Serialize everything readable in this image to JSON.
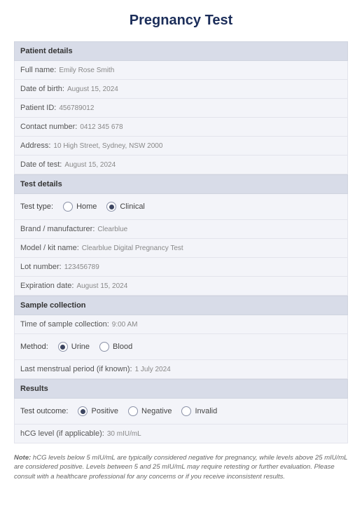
{
  "title": "Pregnancy Test",
  "sections": {
    "patient": {
      "header": "Patient details",
      "fullname_label": "Full name:",
      "fullname_value": "Emily Rose Smith",
      "dob_label": "Date of birth:",
      "dob_value": "August 15, 2024",
      "patientid_label": "Patient ID:",
      "patientid_value": "456789012",
      "contact_label": "Contact number:",
      "contact_value": "0412 345 678",
      "address_label": "Address:",
      "address_value": "10 High Street, Sydney, NSW 2000",
      "testdate_label": "Date of test:",
      "testdate_value": "August 15, 2024"
    },
    "test": {
      "header": "Test details",
      "testtype_label": "Test type:",
      "testtype_options": {
        "home": "Home",
        "clinical": "Clinical"
      },
      "brand_label": "Brand / manufacturer:",
      "brand_value": "Clearblue",
      "model_label": "Model / kit name:",
      "model_value": "Clearblue Digital Pregnancy Test",
      "lot_label": "Lot number:",
      "lot_value": "123456789",
      "expiration_label": "Expiration date:",
      "expiration_value": "August 15, 2024"
    },
    "sample": {
      "header": "Sample collection",
      "time_label": "Time of sample collection:",
      "time_value": "9:00 AM",
      "method_label": "Method:",
      "method_options": {
        "urine": "Urine",
        "blood": "Blood"
      },
      "lmp_label": "Last menstrual period (if known):",
      "lmp_value": "1 July 2024"
    },
    "results": {
      "header": "Results",
      "outcome_label": "Test outcome:",
      "outcome_options": {
        "positive": "Positive",
        "negative": "Negative",
        "invalid": "Invalid"
      },
      "hcg_label": "hCG level (if applicable):",
      "hcg_value": "30 mIU/mL"
    }
  },
  "note_label": "Note:",
  "note_text": " hCG levels below 5 mIU/mL are typically considered negative for pregnancy, while levels above 25 mIU/mL are considered positive. Levels between 5 and 25 mIU/mL may require retesting or further evaluation. Please consult with a healthcare professional for any concerns or if you receive inconsistent results."
}
